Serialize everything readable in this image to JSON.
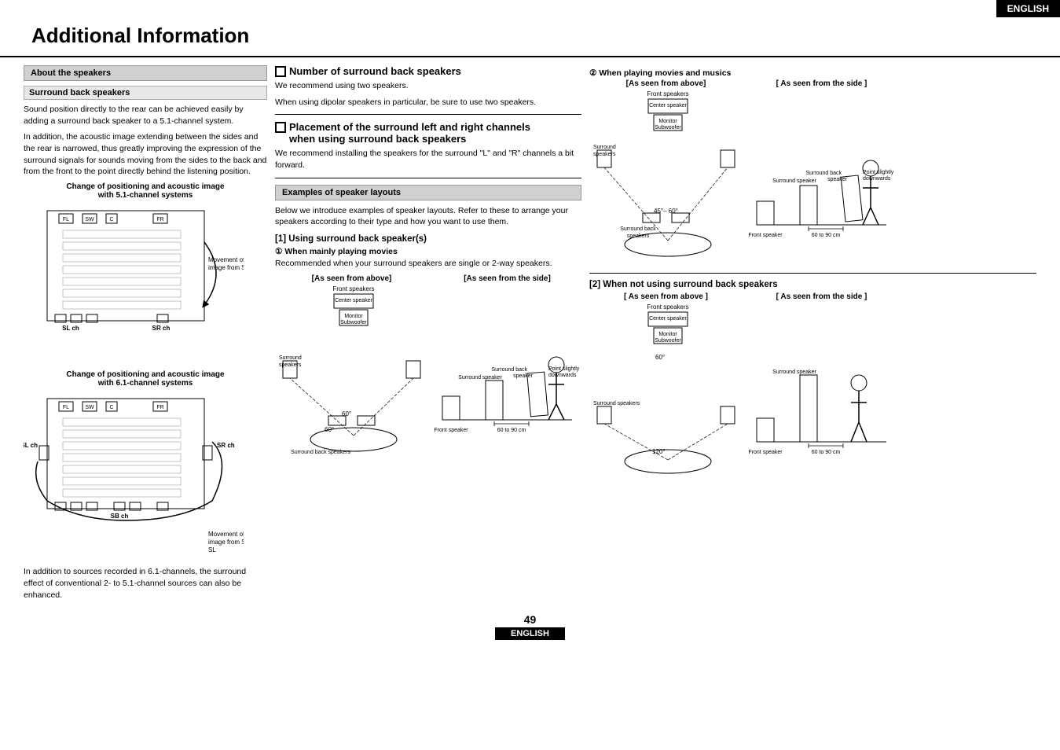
{
  "page": {
    "english_label": "ENGLISH",
    "title": "Additional Information",
    "page_number": "49"
  },
  "left_section": {
    "about_header": "About the speakers",
    "surround_header": "Surround back speakers",
    "surround_body1": "Sound position directly to the rear can be achieved easily by adding a surround back speaker to a 5.1-channel system.",
    "surround_body2": "In addition, the acoustic image extending between the sides and the rear is narrowed, thus greatly improving the expression of the surround signals for sounds moving from the sides to the back and from the front to the point directly behind the listening position.",
    "diagram1_title1": "Change of positioning and acoustic image",
    "diagram1_title2": "with 5.1-channel systems",
    "diagram1_caption": "Movement of acoustic image from SR to SL",
    "diagram1_sl": "SL ch",
    "diagram1_sr": "SR ch",
    "diagram2_title1": "Change of positioning and acoustic image",
    "diagram2_title2": "with 6.1-channel systems",
    "diagram2_caption": "Movement of acoustic image from SR to SB to SL",
    "diagram2_sl": "SL ch",
    "diagram2_sr": "SR ch",
    "diagram2_sb": "SB ch",
    "bottom_text": "In addition to sources recorded in 6.1-channels, the surround effect of conventional 2- to 5.1-channel sources can also be enhanced."
  },
  "mid_section": {
    "num_surround_title": "Number of surround back speakers",
    "num_surround_body1": "We recommend using two speakers.",
    "num_surround_body2": "When using dipolar speakers in particular, be sure to use two speakers.",
    "placement_title_line1": "Placement of the surround left and right channels",
    "placement_title_line2": "when using surround back speakers",
    "placement_body": "We recommend installing the speakers for the surround \"L\" and \"R\" channels a bit forward.",
    "examples_header": "Examples of speaker layouts",
    "examples_body": "Below we introduce examples of speaker layouts. Refer to these to arrange your speakers according to their type and how you want to use them.",
    "section1_title": "[1] Using surround back speaker(s)",
    "when1_title": "① When mainly playing movies",
    "when1_body": "Recommended when your surround speakers are single or 2-way speakers.",
    "above_label1": "[As seen from above]",
    "side_label1": "[As seen from the side]",
    "diagram_above_labels": {
      "front_speakers": "Front speakers",
      "center_speaker": "Center speaker",
      "monitor": "Monitor",
      "subwoofer": "Subwoofer",
      "surround_speakers": "Surround\nspeakers",
      "surround_back": "Surround back speakers",
      "angle": "60°",
      "angle2": "60°"
    },
    "diagram_side_labels": {
      "surround_speaker": "Surround speaker",
      "surround_back_speaker": "Surround back\nspeaker",
      "front_speaker": "Front speaker",
      "distance": "60 to 90 cm",
      "point": "Point slightly\ndownwards"
    }
  },
  "right_section": {
    "when2_title": "② When playing movies and musics",
    "above_label2": "[As seen from above]",
    "side_label2": "[ As seen from the side ]",
    "diagram2_labels": {
      "front_speakers": "Front speakers",
      "center_speaker": "Center speaker",
      "monitor": "Monitor",
      "subwoofer": "Subwoofer",
      "angle": "45° – 60°",
      "surround_speakers": "Surround\nspeakers",
      "surround_back": "Surround back\nspeakers",
      "surround_speaker_side": "Surround speaker",
      "surround_back_side": "Surround back\nspeaker",
      "front_speaker_side": "Front speaker",
      "distance_side": "60 to 90 cm",
      "point_side": "Point slightly\ndownwards"
    },
    "section2_title": "[2] When not using surround back speakers",
    "above_label3": "[ As seen from above ]",
    "side_label3": "[ As seen from the side ]",
    "diagram3_labels": {
      "front_speakers": "Front speakers",
      "center_speaker": "Center speaker",
      "monitor": "Monitor",
      "subwoofer": "Subwoofer",
      "angle": "60°",
      "surround_speakers": "Surround speakers",
      "angle2": "120°",
      "surround_speaker_side": "Surround speaker",
      "front_speaker_side": "Front speaker",
      "distance_side": "60 to 90 cm"
    }
  }
}
